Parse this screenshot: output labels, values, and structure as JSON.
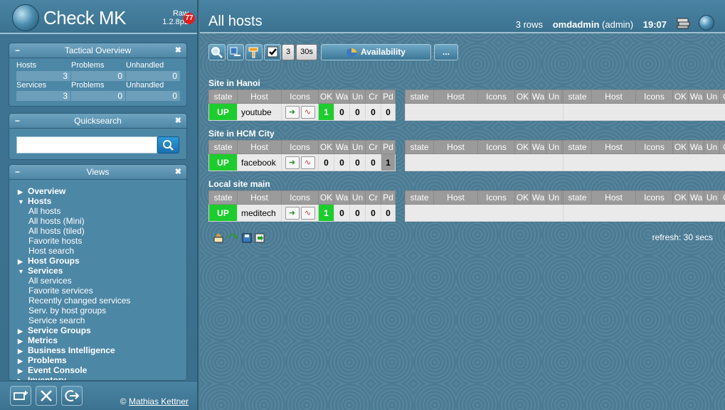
{
  "sidebar": {
    "logo_text": "Check MK",
    "edition": "Raw",
    "version": "1.2.8p2",
    "notification_count": "77",
    "tactical": {
      "title": "Tactical Overview",
      "hosts_label": "Hosts",
      "services_label": "Services",
      "problems_label": "Problems",
      "unhandled_label": "Unhandled",
      "hosts_total": "3",
      "hosts_problems": "0",
      "hosts_unhandled": "0",
      "services_total": "3",
      "services_problems": "0",
      "services_unhandled": "0"
    },
    "quicksearch": {
      "title": "Quicksearch",
      "value": ""
    },
    "views": {
      "title": "Views",
      "items": [
        {
          "label": "Overview",
          "level": "top",
          "expanded": false
        },
        {
          "label": "Hosts",
          "level": "top",
          "expanded": true
        },
        {
          "label": "All hosts",
          "level": "sub"
        },
        {
          "label": "All hosts (Mini)",
          "level": "sub"
        },
        {
          "label": "All hosts (tiled)",
          "level": "sub"
        },
        {
          "label": "Favorite hosts",
          "level": "sub"
        },
        {
          "label": "Host search",
          "level": "sub"
        },
        {
          "label": "Host Groups",
          "level": "top",
          "expanded": false
        },
        {
          "label": "Services",
          "level": "top",
          "expanded": true
        },
        {
          "label": "All services",
          "level": "sub"
        },
        {
          "label": "Favorite services",
          "level": "sub"
        },
        {
          "label": "Recently changed services",
          "level": "sub"
        },
        {
          "label": "Serv. by host groups",
          "level": "sub"
        },
        {
          "label": "Service search",
          "level": "sub"
        },
        {
          "label": "Service Groups",
          "level": "top",
          "expanded": false
        },
        {
          "label": "Metrics",
          "level": "top",
          "expanded": false
        },
        {
          "label": "Business Intelligence",
          "level": "top",
          "expanded": false
        },
        {
          "label": "Problems",
          "level": "top",
          "expanded": false
        },
        {
          "label": "Event Console",
          "level": "top",
          "expanded": false
        },
        {
          "label": "Inventory",
          "level": "top",
          "expanded": false
        }
      ]
    },
    "footer": {
      "copyright_symbol": "©",
      "copyright_name": "Mathias Kettner"
    }
  },
  "topbar": {
    "title": "All hosts",
    "rows": "3 rows",
    "user": "omdadmin",
    "role": "(admin)",
    "time": "19:07"
  },
  "toolbar": {
    "refresh_count": "3",
    "refresh_interval": "30s",
    "availability_label": "Availability",
    "more_label": "..."
  },
  "table_columns": [
    "state",
    "Host",
    "Icons",
    "OK",
    "Wa",
    "Un",
    "Cr",
    "Pd"
  ],
  "sites": [
    {
      "title": "Site in Hanoi",
      "host": {
        "state": "UP",
        "name": "youtube",
        "ok": "1",
        "wa": "0",
        "un": "0",
        "cr": "0",
        "pd": "0",
        "ok_green": true,
        "pd_grey": false
      }
    },
    {
      "title": "Site in HCM City",
      "host": {
        "state": "UP",
        "name": "facebook",
        "ok": "0",
        "wa": "0",
        "un": "0",
        "cr": "0",
        "pd": "1",
        "ok_green": false,
        "pd_grey": true
      }
    },
    {
      "title": "Local site main",
      "host": {
        "state": "UP",
        "name": "meditech",
        "ok": "1",
        "wa": "0",
        "un": "0",
        "cr": "0",
        "pd": "0",
        "ok_green": true,
        "pd_grey": false
      }
    }
  ],
  "footer": {
    "refresh_text": "refresh: 30 secs"
  },
  "colors": {
    "state_up": "#1dcc2d",
    "header_grey": "#9b9b9b",
    "cell_bg": "#eaeaea",
    "badge_red": "#e01e1e"
  }
}
